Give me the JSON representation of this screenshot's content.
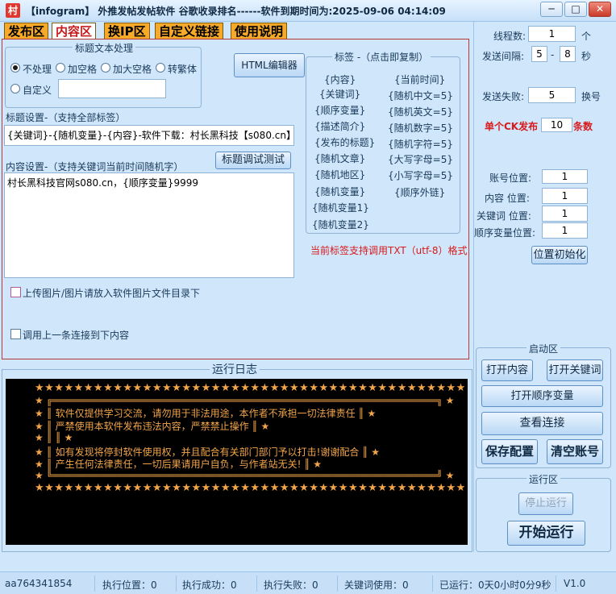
{
  "window": {
    "title": "【infogram】 外推发帖发帖软件   谷歌收录排名------软件到期时间为:2025-09-06 04:14:09",
    "icon_char": "村",
    "minimize": "─",
    "maximize": "□",
    "close": "✕"
  },
  "tabs": [
    {
      "label": "发布区"
    },
    {
      "label": "内容区"
    },
    {
      "label": "换IP区"
    },
    {
      "label": "自定义链接"
    },
    {
      "label": "使用说明"
    }
  ],
  "title_processing": {
    "group_label": "标题文本处理",
    "options": [
      "不处理",
      "加空格",
      "加大空格",
      "转繁体"
    ],
    "custom_label": "自定义",
    "custom_value": "",
    "selected": "不处理"
  },
  "html_editor_button": "HTML编辑器",
  "tags_panel": {
    "title": "标签 -（点击即复制）",
    "left": [
      "{内容}",
      "{关键词}",
      "{顺序变量}",
      "{描述简介}",
      "{发布的标题}",
      "{随机文章}",
      "{随机地区}",
      "{随机变量}",
      "{随机变量1}",
      "{随机变量2}"
    ],
    "right": [
      "{当前时间}",
      "{随机中文=5}",
      "{随机英文=5}",
      "{随机数字=5}",
      "{随机字符=5}",
      "{大写字母=5}",
      "{小写字母=5}",
      "{顺序外链}"
    ]
  },
  "title_settings": {
    "label": "标题设置-（支持全部标签）",
    "value": "{关键词}-{随机变量}-{内容}-软件下载：村长黑科技【s080.cn】"
  },
  "title_test_button": "标题调试测试",
  "content_settings": {
    "label": "内容设置-（支持关键词当前时间随机字）",
    "value": "村长黑科技官网s080.cn，{顺序变量}9999"
  },
  "encoding_note": "当前标签支持调用TXT（utf-8）格式",
  "upload_image_check": "上传图片/图片请放入软件图片文件目录下",
  "prev_link_check": "调用上一条连接到下内容",
  "log": {
    "title": "运行日志",
    "stars": "★★★★★★★★★★★★★★★★★★★★★★★★★★★★★★★★★★★★★★★★★★★★",
    "lines": [
      "★ ║  软件仅提供学习交流，请勿用于非法用途，本作者不承担一切法律责任  ║ ★",
      "★ ║  严禁使用本软件发布违法内容，严禁禁止操作                          ║ ★",
      "★ ║                                                                    ║ ★",
      "★ ║  如有发现将停封软件使用权，并且配合有关部门部门予以打击!谢谢配合  ║ ★",
      "★ ║  产生任何法律责任，一切后果请用户自负，与作者站无关!              ║ ★"
    ],
    "border_top": "★ ╔══════════════════════════════════════════════════════════════════╗ ★",
    "border_bottom": "★ ╚══════════════════════════════════════════════════════════════════╝ ★"
  },
  "right": {
    "threads_label": "线程数:",
    "threads": "1",
    "threads_unit": "个",
    "interval_label": "发送间隔:",
    "interval_min": "5",
    "interval_dash": "-",
    "interval_max": "8",
    "interval_unit": "秒",
    "fail_label": "发送失败:",
    "fail_value": "5",
    "fail_unit": "换号",
    "ck_label": "单个CK发布",
    "ck_value": "10",
    "ck_unit": "条数",
    "account_pos_label": "账号位置:",
    "account_pos": "1",
    "content_pos_label": "内容 位置:",
    "content_pos": "1",
    "keyword_pos_label": "关键词 位置:",
    "keyword_pos": "1",
    "seqvar_pos_label": "顺序变量位置:",
    "seqvar_pos": "1",
    "reset_button": "位置初始化",
    "start_zone_label": "启动区",
    "open_content": "打开内容",
    "open_keywords": "打开关键词",
    "open_seqvar": "打开顺序变量",
    "view_links": "查看连接",
    "save_config": "保存配置",
    "clear_accounts": "清空账号",
    "run_zone_label": "运行区",
    "stop_button": "停止运行",
    "start_button": "开始运行"
  },
  "status": {
    "account": "aa764341854",
    "exec_pos": "执行位置：0",
    "exec_ok": "执行成功：0",
    "exec_fail": "执行失败：0",
    "kw_used": "关键词使用：0",
    "elapsed": "已运行：0天0小时0分9秒",
    "version": "V1.0"
  },
  "colors": {
    "window_bg": "#cfe6fb",
    "tab_orange": "#f7a928",
    "active_tab_text": "#c61a1a",
    "console_bg": "#000000",
    "console_text": "#f2a54a",
    "warning_red": "#d81a1a"
  }
}
